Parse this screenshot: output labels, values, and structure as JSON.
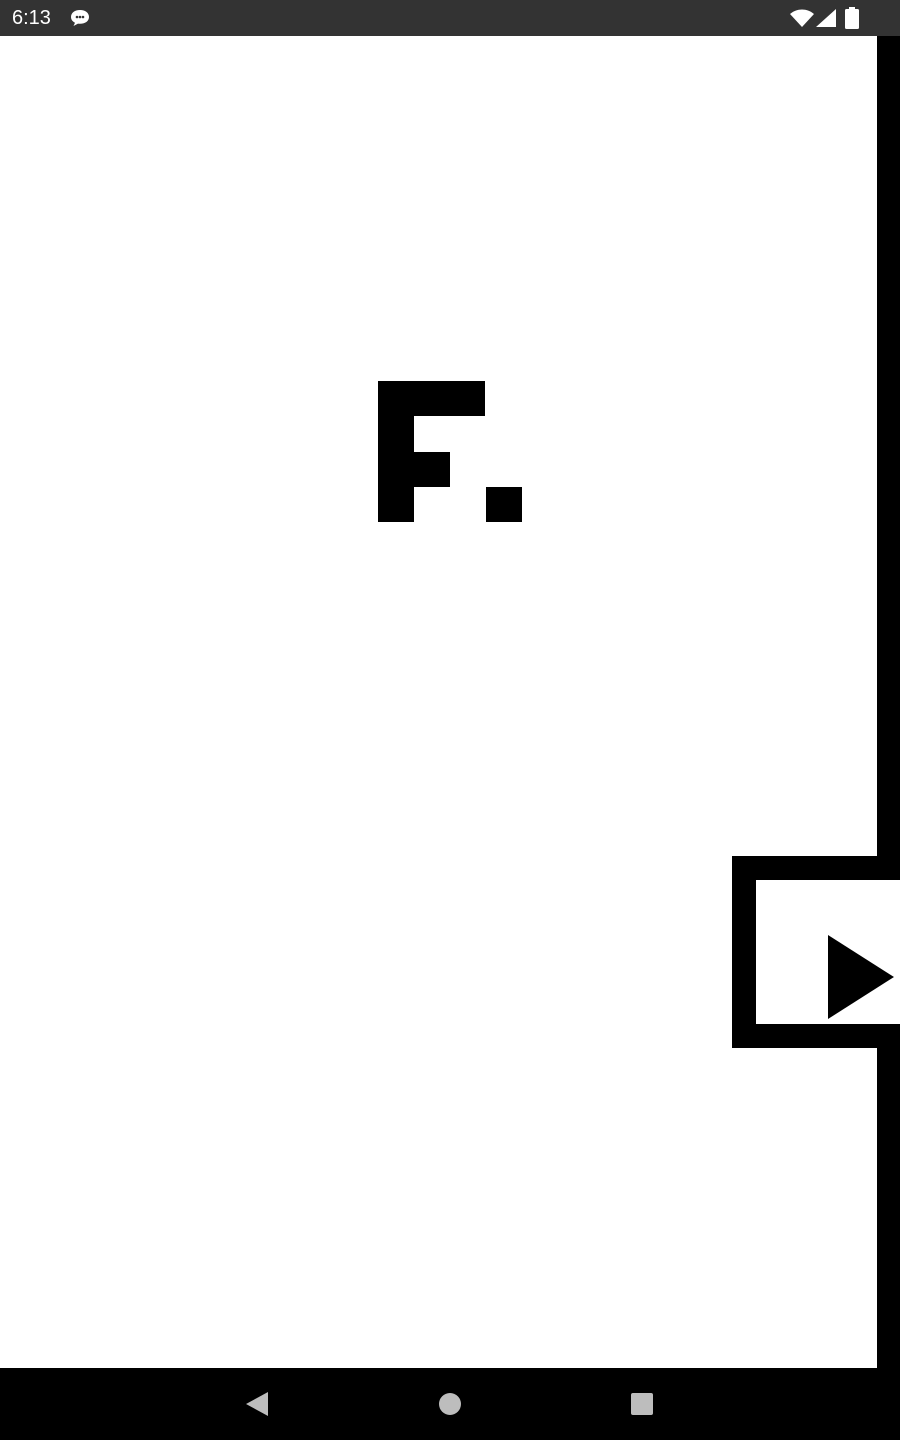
{
  "status_bar": {
    "time": "6:13",
    "notification_icon": "message-bubble-icon",
    "wifi_icon": "wifi-icon",
    "signal_icon": "cell-signal-icon",
    "battery_icon": "battery-icon"
  },
  "app": {
    "logo_icon": "pixel-f-logo-icon",
    "next_button_icon": "play-triangle-icon"
  },
  "nav_bar": {
    "back_icon": "back-triangle-icon",
    "home_icon": "home-circle-icon",
    "recents_icon": "recents-square-icon"
  },
  "colors": {
    "status_bar_bg": "#333333",
    "app_bg": "#ffffff",
    "foreground": "#000000",
    "nav_icon": "#bdbdbd"
  }
}
